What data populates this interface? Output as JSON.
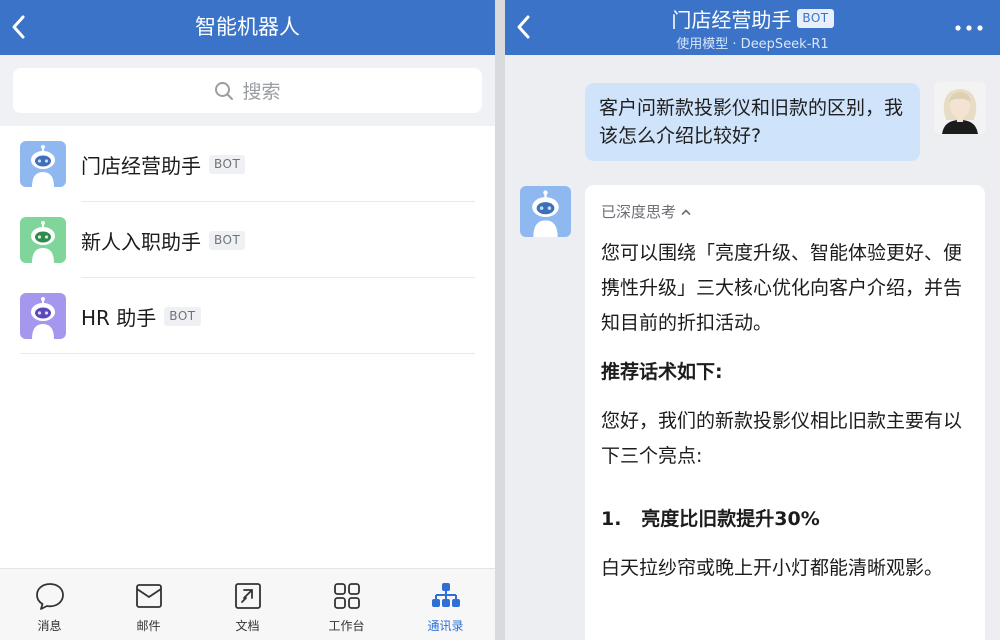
{
  "left": {
    "title": "智能机器人",
    "search": {
      "placeholder": "搜索"
    },
    "bots": [
      {
        "name": "门店经营助手",
        "badge": "BOT"
      },
      {
        "name": "新人入职助手",
        "badge": "BOT"
      },
      {
        "name": "HR 助手",
        "badge": "BOT"
      }
    ],
    "tabs": [
      {
        "label": "消息",
        "icon": "chat-bubble-icon"
      },
      {
        "label": "邮件",
        "icon": "mail-icon"
      },
      {
        "label": "文档",
        "icon": "document-icon"
      },
      {
        "label": "工作台",
        "icon": "grid-icon"
      },
      {
        "label": "通讯录",
        "icon": "org-chart-icon",
        "active": true
      }
    ]
  },
  "right": {
    "title": "门店经营助手",
    "badge": "BOT",
    "subtitle": "使用模型 · DeepSeek-R1",
    "user_message": "客户问新款投影仪和旧款的区别，我该怎么介绍比较好?",
    "bot_reply": {
      "thinking_label": "已深度思考",
      "paragraph1": "您可以围绕「亮度升级、智能体验更好、便携性升级」三大核心优化向客户介绍，并告知目前的折扣活动。",
      "heading": "推荐话术如下:",
      "paragraph2": "您好，我们的新款投影仪相比旧款主要有以下三个亮点:",
      "point1_title": "1.   亮度比旧款提升30%",
      "point1_body": "白天拉纱帘或晚上开小灯都能清晰观影。"
    }
  },
  "colors": {
    "header": "#3a73c8",
    "user_bubble": "#cfe3fb",
    "active_tab": "#2f6fd6",
    "chat_bg": "#eceef2"
  }
}
